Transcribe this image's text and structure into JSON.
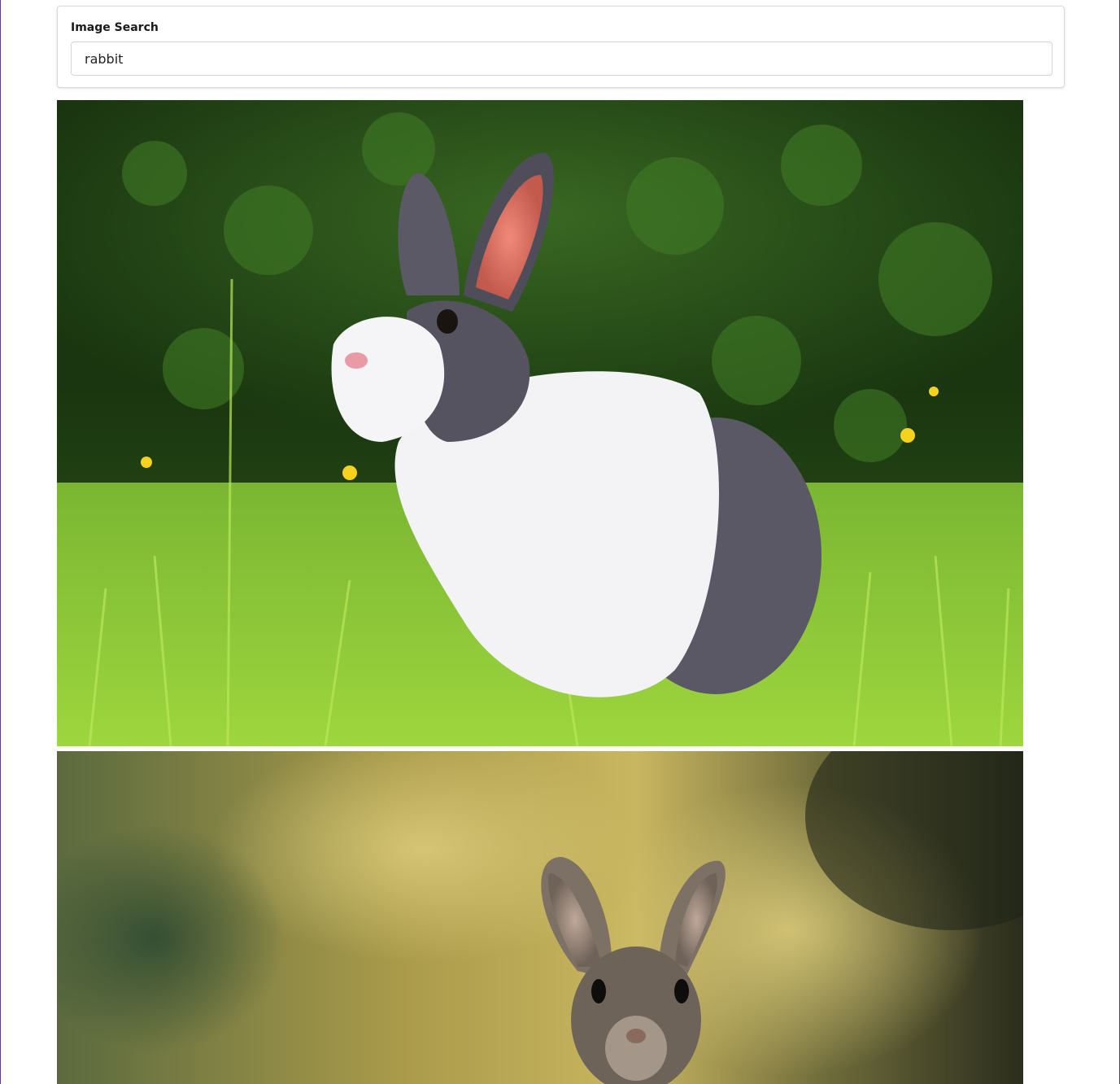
{
  "search": {
    "label": "Image Search",
    "value": "rabbit"
  },
  "results": [
    {
      "subject": "rabbit-grass-photo"
    },
    {
      "subject": "rabbit-bokeh-photo"
    }
  ]
}
